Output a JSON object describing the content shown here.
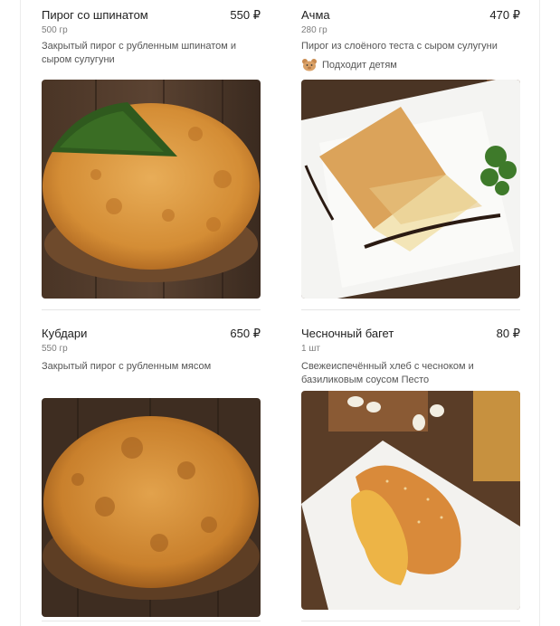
{
  "items": [
    {
      "name": "Пирог со шпинатом",
      "price": "550 ₽",
      "weight": "500 гр",
      "description": "Закрытый пирог с рубленным шпинатом и сыром сулугуни",
      "image": "spinach-pie-photo"
    },
    {
      "name": "Ачма",
      "price": "470 ₽",
      "weight": "280 гр",
      "description": "Пирог из слоёного теста с сыром сулугуни",
      "badge": "Подходит детям",
      "image": "achma-photo"
    },
    {
      "name": "Кубдари",
      "price": "650 ₽",
      "weight": "550 гр",
      "description": "Закрытый пирог с рубленным мясом",
      "image": "kubdari-photo"
    },
    {
      "name": "Чесночный багет",
      "price": "80 ₽",
      "weight": "1 шт",
      "description": "Свежеиспечённый хлеб с чесноком и базиликовым соусом Песто",
      "image": "garlic-baguette-photo"
    }
  ],
  "colors": {
    "wood_dark": "#3b2a1f",
    "crust": "#d9973d",
    "spinach": "#2f5a1e",
    "plate": "#f4f4f2"
  }
}
